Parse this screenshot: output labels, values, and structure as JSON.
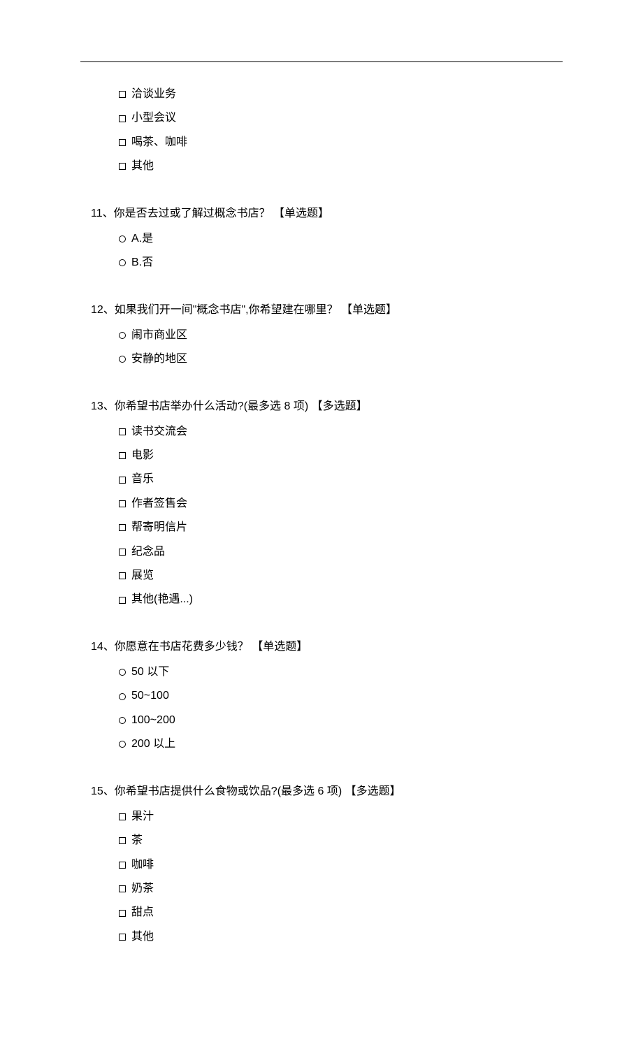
{
  "q10_remaining": {
    "options": [
      "洽谈业务",
      "小型会议",
      "喝茶、咖啡",
      "其他"
    ]
  },
  "q11": {
    "title": "11、你是否去过或了解过概念书店？ 【单选题】",
    "options": [
      "A.是",
      "B.否"
    ]
  },
  "q12": {
    "title": "12、如果我们开一间\"概念书店\",你希望建在哪里？  【单选题】",
    "options": [
      "闹市商业区",
      "安静的地区"
    ]
  },
  "q13": {
    "title": "13、你希望书店举办什么活动?(最多选 8 项)  【多选题】",
    "options": [
      "读书交流会",
      "电影",
      "音乐",
      "作者签售会",
      "帮寄明信片",
      "纪念品",
      "展览",
      "其他(艳遇...)"
    ]
  },
  "q14": {
    "title": "14、你愿意在书店花费多少钱？ 【单选题】",
    "options": [
      "50 以下",
      "50~100",
      "100~200",
      "200 以上"
    ]
  },
  "q15": {
    "title": "15、你希望书店提供什么食物或饮品?(最多选 6 项)  【多选题】",
    "options": [
      "果汁",
      "茶",
      "咖啡",
      "奶茶",
      "甜点",
      "其他"
    ]
  }
}
